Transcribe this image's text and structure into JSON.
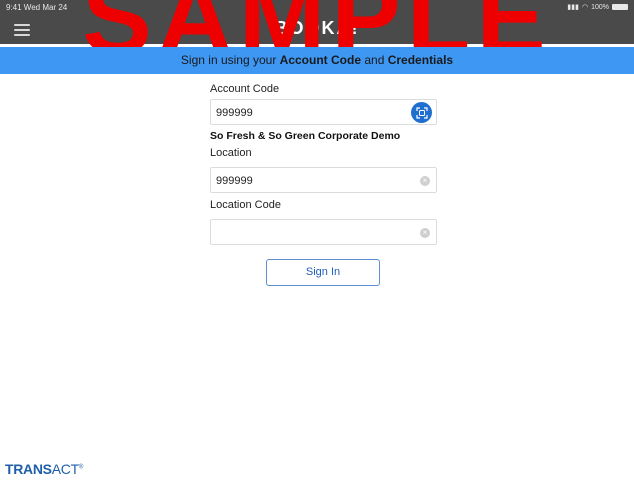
{
  "status_bar": {
    "time": "9:41 Wed Mar 24",
    "battery": "100%"
  },
  "header": {
    "app_title": "BOOKA!",
    "watermark": "SAMPLE"
  },
  "banner": {
    "prefix": "Sign in using your",
    "account_code": "Account Code",
    "and": "and",
    "credentials": "Credentials"
  },
  "form": {
    "account_code_label": "Account Code",
    "account_code_value": "999999",
    "org_name": "So Fresh & So Green Corporate Demo",
    "location_label": "Location",
    "location_value": "999999",
    "location_code_label": "Location Code",
    "location_code_value": ""
  },
  "signin_label": "Sign In",
  "brand": {
    "strong": "TRANS",
    "rest": "ACT",
    "mark": "®"
  },
  "colors": {
    "banner": "#3d97f3",
    "topbar": "#4a4a4a",
    "watermark": "#ee0000",
    "accent": "#1f6fd1"
  }
}
